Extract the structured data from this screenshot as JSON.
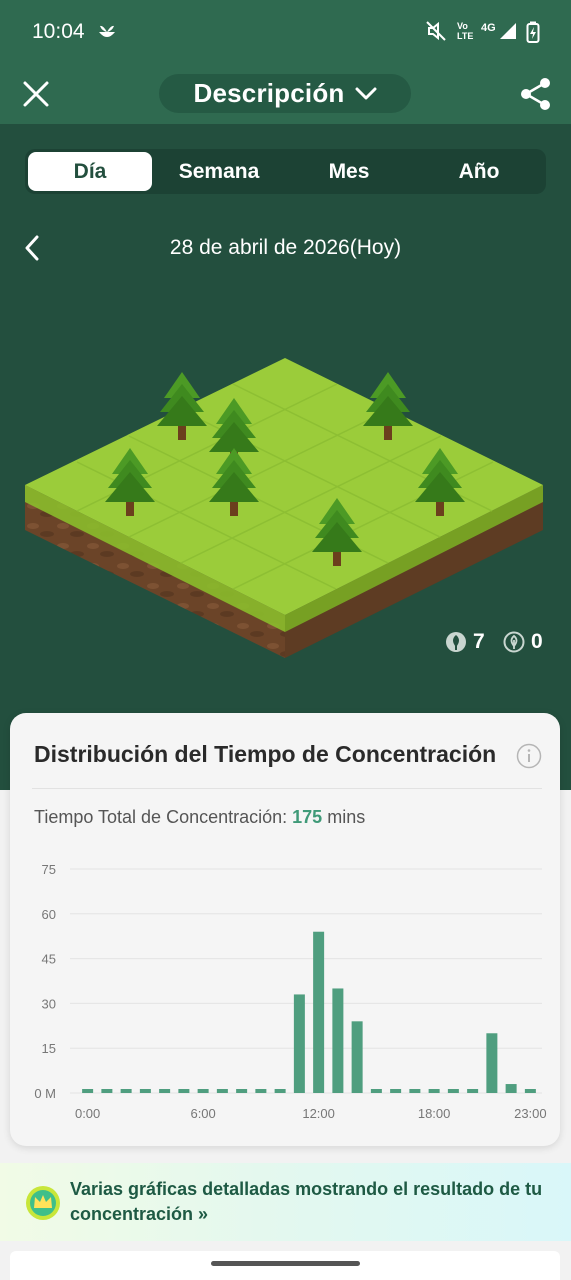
{
  "status_bar": {
    "time": "10:04",
    "volte_line1": "Vo",
    "volte_line2": "LTE",
    "network": "4G",
    "icons": [
      "app-notification-icon",
      "mute-icon",
      "signal-icon",
      "battery-charging-icon"
    ]
  },
  "header": {
    "title": "Descripción",
    "close_icon": "close-icon",
    "dropdown_icon": "chevron-down-icon",
    "share_icon": "share-icon"
  },
  "tabs": [
    {
      "label": "Día",
      "active": true
    },
    {
      "label": "Semana",
      "active": false
    },
    {
      "label": "Mes",
      "active": false
    },
    {
      "label": "Año",
      "active": false
    }
  ],
  "date_nav": {
    "back_icon": "chevron-left-icon",
    "date": "28 de abril de 2026(Hoy)"
  },
  "forest": {
    "healthy_trees": "7",
    "dead_trees": "0"
  },
  "card": {
    "title": "Distribución del Tiempo de Concentración",
    "info_icon": "info-icon",
    "total_label": "Tiempo Total de Concentración: ",
    "total_value": "175",
    "total_unit": " mins"
  },
  "chart_data": {
    "type": "bar",
    "y_ticks": [
      "75",
      "60",
      "45",
      "30",
      "15",
      "0 M"
    ],
    "x_tick_labels": [
      "0:00",
      "6:00",
      "12:00",
      "18:00",
      "23:00"
    ],
    "ylim": [
      0,
      75
    ],
    "categories": [
      0,
      1,
      2,
      3,
      4,
      5,
      6,
      7,
      8,
      9,
      10,
      11,
      12,
      13,
      14,
      15,
      16,
      17,
      18,
      19,
      20,
      21,
      22,
      23
    ],
    "values": [
      0,
      0,
      0,
      0,
      0,
      0,
      0,
      0,
      0,
      0,
      0,
      33,
      54,
      35,
      24,
      0,
      0,
      0,
      0,
      0,
      0,
      20,
      3,
      0
    ],
    "grid": true,
    "bar_color": "#4f9e7f"
  },
  "promo": {
    "text": "Varias gráficas detalladas mostrando el resultado de tu concentración",
    "arrow": "»",
    "icon": "crown-icon"
  },
  "colors": {
    "dark_green": "#234f3e",
    "header_green": "#2f6a50",
    "accent": "#3f9a78"
  }
}
